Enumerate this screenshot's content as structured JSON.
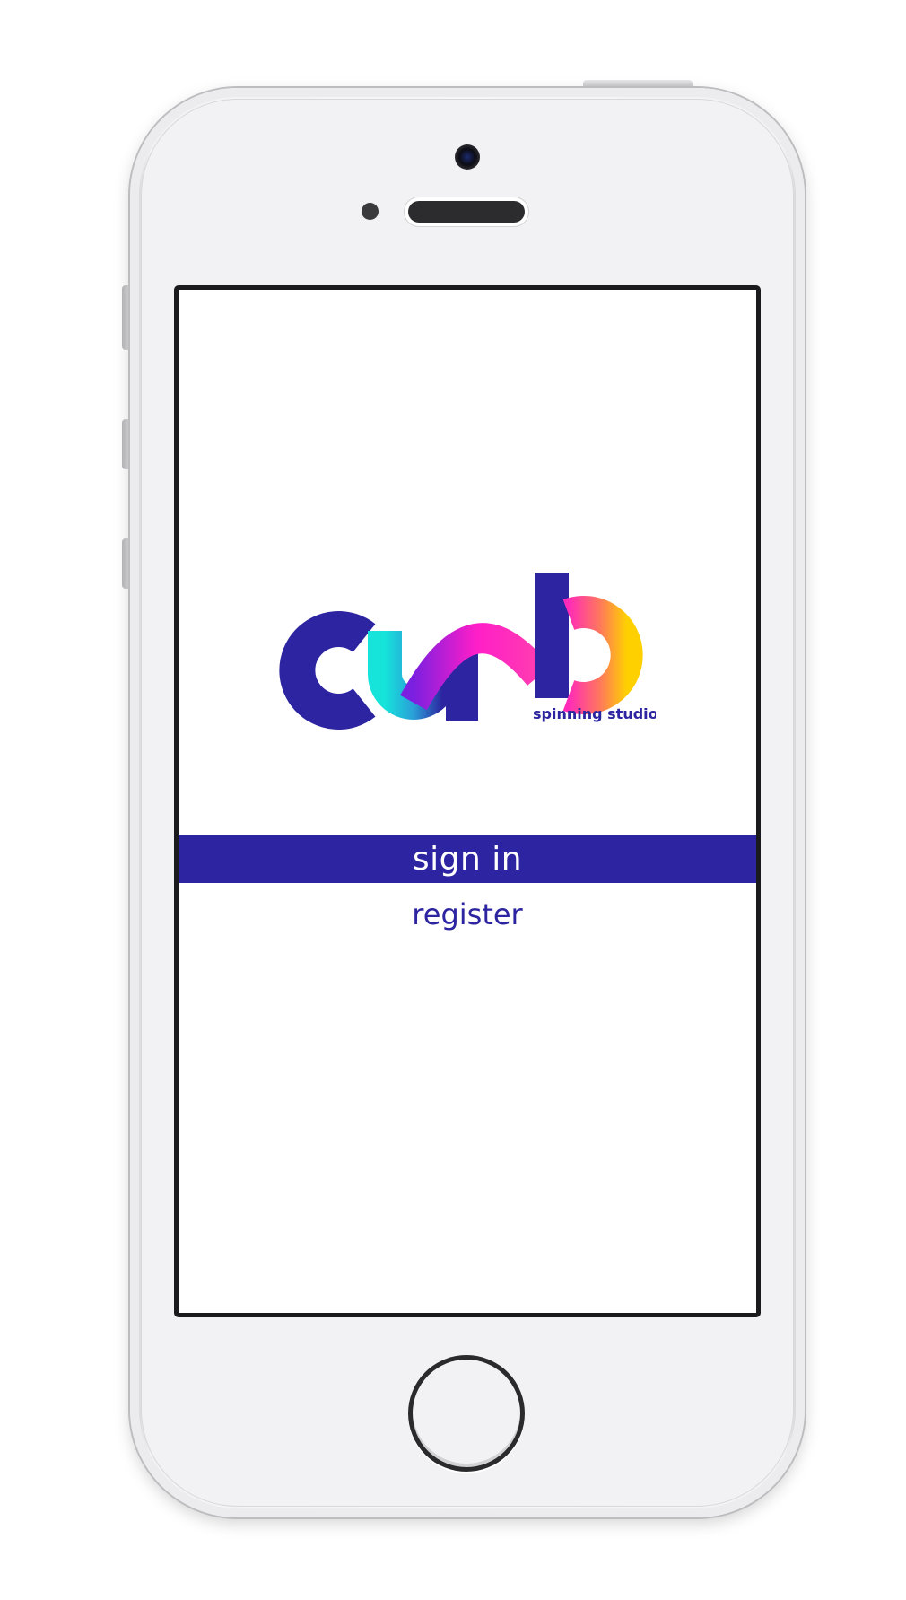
{
  "app": {
    "logo_text": "curb",
    "logo_subtitle": "spinning studio"
  },
  "auth": {
    "signin_label": "sign in",
    "register_label": "register"
  },
  "colors": {
    "brand": "#2c24a0",
    "logo_gradient": [
      "#16e3da",
      "#a020f0",
      "#ff1ec8",
      "#ffcc00"
    ]
  },
  "icons": [
    "front-camera-icon",
    "proximity-sensor-icon",
    "earpiece-speaker-icon",
    "home-button-icon"
  ]
}
